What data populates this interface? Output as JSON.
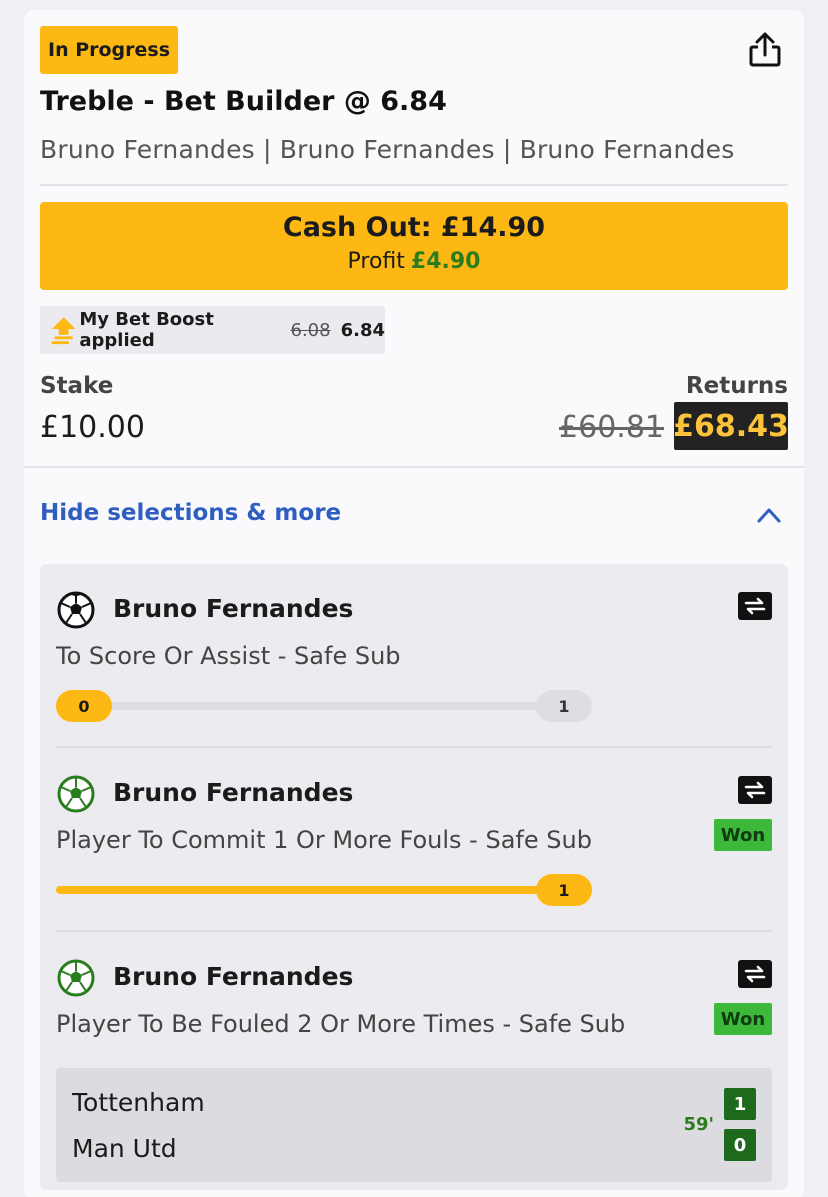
{
  "bet": {
    "status": "In Progress",
    "title": "Treble - Bet Builder @ 6.84",
    "summary": "Bruno Fernandes | Bruno Fernandes | Bruno Fernandes"
  },
  "cashout": {
    "label": "Cash Out: £14.90",
    "profit_label": "Profit",
    "profit_value": "£4.90"
  },
  "boost": {
    "label": "My Bet Boost applied",
    "old_odds": "6.08",
    "new_odds": "6.84"
  },
  "stake": {
    "label": "Stake",
    "value": "£10.00"
  },
  "returns": {
    "label": "Returns",
    "old_value": "£60.81",
    "new_value": "£68.43"
  },
  "toggle": {
    "label": "Hide selections & more"
  },
  "selections": [
    {
      "player": "Bruno Fernandes",
      "market": "To Score Or Assist - Safe Sub",
      "progress_current": "0",
      "progress_target": "1",
      "progress_fraction": 0,
      "status": ""
    },
    {
      "player": "Bruno Fernandes",
      "market": "Player To Commit 1 Or More Fouls - Safe Sub",
      "progress_target": "1",
      "progress_fraction": 1,
      "status": "Won"
    },
    {
      "player": "Bruno Fernandes",
      "market": "Player To Be Fouled 2 Or More Times - Safe Sub",
      "status": "Won"
    }
  ],
  "match": {
    "home_team": "Tottenham",
    "away_team": "Man Utd",
    "minute": "59'",
    "home_score": "1",
    "away_score": "0"
  },
  "colors": {
    "accent": "#fdb813",
    "profit_green": "#2a7d1f",
    "link_blue": "#2f5ec0",
    "won_green": "#3cb83a",
    "score_green": "#1e6a1c",
    "returns_bg": "#222222",
    "returns_text": "#fdc33a"
  },
  "icons": {
    "share": "share-icon",
    "boost": "boost-arrow-icon",
    "chevron": "chevron-up-icon",
    "ball": "football-icon",
    "swap": "swap-icon"
  }
}
